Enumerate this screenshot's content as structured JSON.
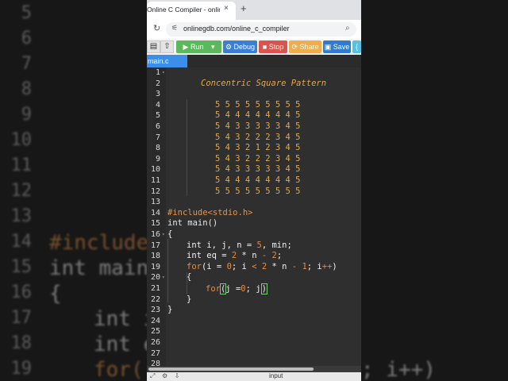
{
  "background": {
    "left_line_numbers": [
      "5",
      "6",
      "7",
      "8",
      "9",
      "10",
      "11",
      "12",
      "13",
      "14",
      "15",
      "16",
      "17",
      "18",
      "19"
    ],
    "code_fragments": [
      "#include",
      "int main(",
      "{",
      "int i",
      "int e",
      "for("
    ],
    "right_fragment": "; i++)"
  },
  "browser": {
    "tab_title": "Online C Compiler - online edi",
    "tab_close": "×",
    "new_tab": "+",
    "url": "onlinegdb.com/online_c_compiler"
  },
  "toolbar": {
    "run_label": "Run",
    "debug_label": "Debug",
    "stop_label": "Stop",
    "share_label": "Share",
    "save_label": "Save",
    "colors": {
      "run": "#5cb85c",
      "debug": "#3a7fd1",
      "stop": "#d9534f",
      "share": "#f0ad4e",
      "save": "#2f7bd1",
      "extra": "#5bc0de"
    }
  },
  "editor": {
    "file_tab": "main.c",
    "line_numbers": [
      "1",
      "2",
      "3",
      "4",
      "5",
      "6",
      "7",
      "8",
      "9",
      "10",
      "11",
      "12",
      "13",
      "14",
      "15",
      "16",
      "17",
      "18",
      "19",
      "20",
      "21",
      "22",
      "23",
      "24",
      "25",
      "26",
      "27",
      "28"
    ],
    "comment_title": "Concentric Square Pattern",
    "pattern": [
      "5 5 5 5 5 5 5 5 5",
      "5 4 4 4 4 4 4 4 5",
      "5 4 3 3 3 3 3 4 5",
      "5 4 3 2 2 2 3 4 5",
      "5 4 3 2 1 2 3 4 5",
      "5 4 3 2 2 2 3 4 5",
      "5 4 3 3 3 3 3 4 5",
      "5 4 4 4 4 4 4 4 5",
      "5 5 5 5 5 5 5 5 5"
    ],
    "code": {
      "include_directive": "#include",
      "include_header": "<stdio.h>",
      "main_decl": "int main()",
      "open_brace": "{",
      "close_brace": "}",
      "decl_prefix": "int i, j, n = ",
      "n_value": "5",
      "decl_suffix": ", min;",
      "eq_prefix": "int eq = ",
      "eq_two": "2",
      "eq_mul": " * n ",
      "eq_minus": "-",
      "eq_sp": " ",
      "eq_two_b": "2",
      "eq_semi": ";",
      "for_kw": "for",
      "for_open": "(i = ",
      "for_zero": "0",
      "for_mid1": "; i ",
      "for_lt": "<",
      "for_sp": " ",
      "for_two": "2",
      "for_mid2": " * n ",
      "for_minus": "-",
      "for_sp2": " ",
      "for_one": "1",
      "for_mid3": "; i",
      "for_pp": "++",
      "for_close": ")",
      "inner_for_kw": "for",
      "inner_paren_open": "(",
      "inner_body1": "j =",
      "inner_zero": "0",
      "inner_body2": "; j",
      "inner_paren_close": ")"
    }
  },
  "bottom": {
    "icons": "⤢ ⚙ ⇩",
    "input_label": "input"
  }
}
